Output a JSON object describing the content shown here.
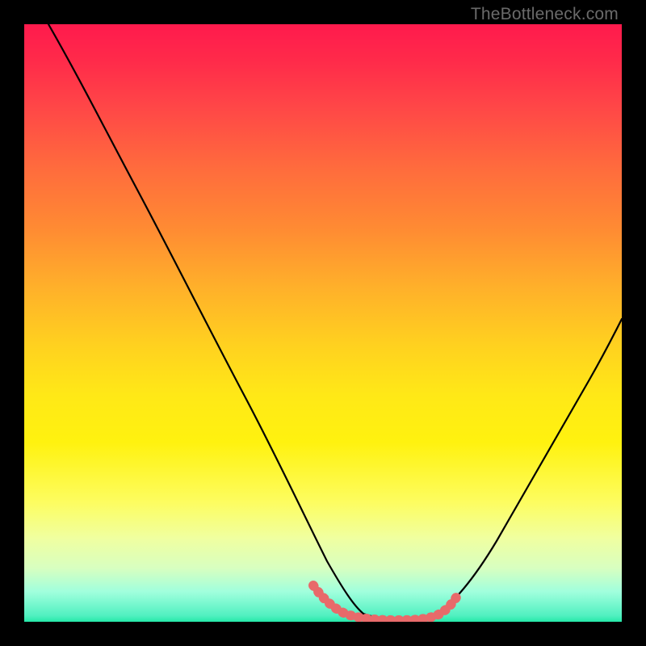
{
  "watermark": "TheBottleneck.com",
  "chart_data": {
    "type": "line",
    "title": "",
    "xlabel": "",
    "ylabel": "",
    "xlim": [
      0,
      100
    ],
    "ylim": [
      0,
      100
    ],
    "grid": false,
    "legend": false,
    "series": [
      {
        "name": "black-curve",
        "color": "#000000",
        "x": [
          4,
          10,
          15,
          20,
          25,
          30,
          35,
          40,
          44,
          48,
          52,
          56,
          60,
          65,
          70,
          75,
          80,
          85,
          90,
          95,
          100
        ],
        "y": [
          100,
          90,
          81,
          72,
          63,
          54,
          45,
          36,
          27,
          18,
          9,
          3,
          0,
          0,
          2,
          8,
          17,
          27,
          37,
          48,
          59
        ]
      },
      {
        "name": "red-flat-segment",
        "color": "#e86a6a",
        "x": [
          48,
          53,
          58,
          62,
          66,
          70
        ],
        "y": [
          4,
          1,
          0,
          0,
          1,
          4
        ]
      }
    ],
    "annotations": []
  },
  "colors": {
    "background": "#000000",
    "gradient_top": "#ff1a4d",
    "gradient_bottom": "#25e8a8",
    "curve": "#000000",
    "flat_segment": "#e86a6a"
  }
}
